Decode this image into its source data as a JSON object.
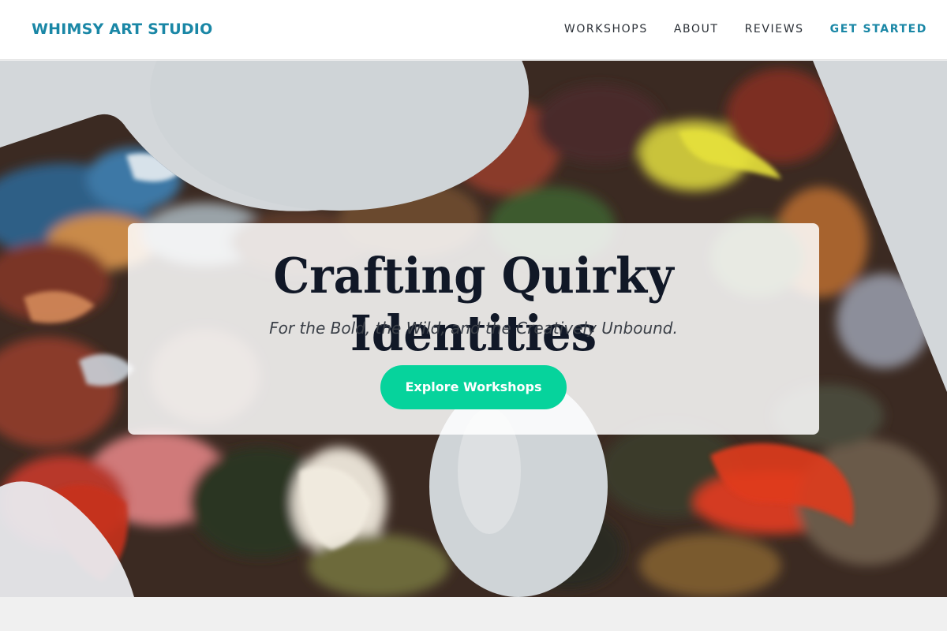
{
  "header": {
    "logo": "WHIMSY ART STUDIO",
    "nav": [
      {
        "label": "WORKSHOPS"
      },
      {
        "label": "ABOUT"
      },
      {
        "label": "REVIEWS"
      },
      {
        "label": "GET STARTED"
      }
    ]
  },
  "hero": {
    "title": "Crafting Quirky Identities",
    "subtitle": "For the Bold, the Wild, and the Creatively Unbound.",
    "cta_label": "Explore Workshops",
    "image": "paint-palette-photo"
  },
  "colors": {
    "brand": "#1a87a6",
    "accent": "#06d39c",
    "title": "#111827"
  }
}
